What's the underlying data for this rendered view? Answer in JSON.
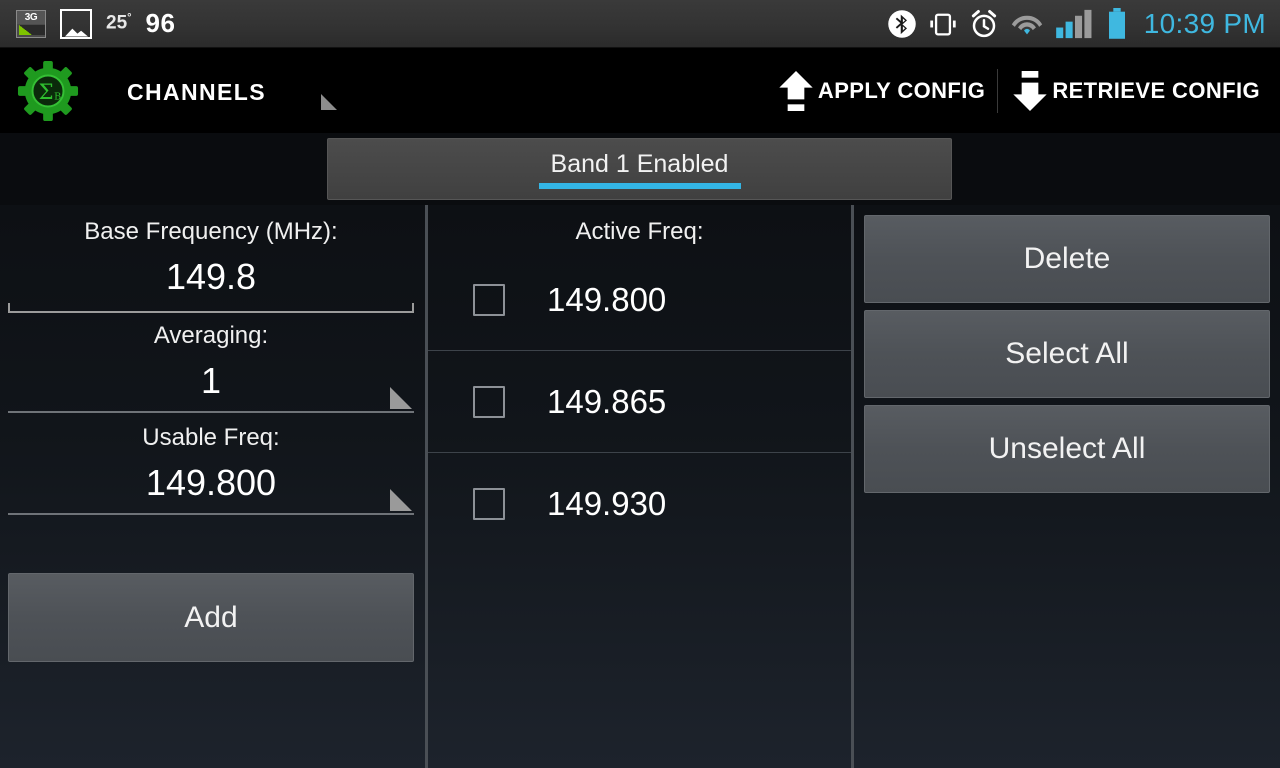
{
  "statusbar": {
    "network_badge": "3G",
    "temperature": "25",
    "temperature_unit": "°",
    "notification_count": "96",
    "time": "10:39 PM",
    "time_color": "#3fb8e0",
    "icons": [
      "3g-icon",
      "photo-icon",
      "bluetooth-icon",
      "vibrate-icon",
      "alarm-icon",
      "wifi-icon",
      "signal-icon",
      "battery-icon"
    ]
  },
  "actionbar": {
    "app_icon": "gear-sigma-logo",
    "title": "CHANNELS",
    "apply_config": "APPLY CONFIG",
    "retrieve_config": "RETRIEVE CONFIG"
  },
  "tab": {
    "label": "Band 1 Enabled",
    "accent_color": "#33b5e5",
    "checked": true
  },
  "left_panel": {
    "base_frequency": {
      "label": "Base Frequency (MHz):",
      "value": "149.8"
    },
    "averaging": {
      "label": "Averaging:",
      "value": "1"
    },
    "usable_freq": {
      "label": "Usable Freq:",
      "value": "149.800"
    },
    "add_button": "Add"
  },
  "active_list": {
    "header": "Active Freq:",
    "rows": [
      {
        "value": "149.800",
        "checked": false
      },
      {
        "value": "149.865",
        "checked": false
      },
      {
        "value": "149.930",
        "checked": false
      }
    ]
  },
  "right_panel": {
    "delete": "Delete",
    "select_all": "Select All",
    "unselect_all": "Unselect All"
  }
}
